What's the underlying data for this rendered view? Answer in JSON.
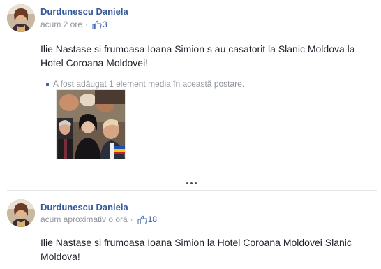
{
  "posts": [
    {
      "author": "Durdunescu Daniela",
      "time": "acum 2 ore",
      "separator": "·",
      "likes": "3",
      "text": "Ilie Nastase si frumoasa Ioana Simion s au casatorit la Slanic Moldova la Hotel Coroana Moldovei!",
      "media_note": "A fost adăugat 1 element media în această postare.",
      "icons": {
        "avatar": "avatar",
        "like": "like-icon",
        "media": "photo-thumbnail"
      }
    },
    {
      "author": "Durdunescu Daniela",
      "time": "acum aproximativ o oră",
      "separator": "·",
      "likes": "18",
      "text": "Ilie Nastase si frumoasa Ioana Simion la Hotel Coroana Moldovei Slanic Moldova!",
      "icons": {
        "avatar": "avatar",
        "like": "like-icon"
      }
    }
  ],
  "more_button": "more-dots-icon",
  "colors": {
    "link": "#365899",
    "meta": "#90949c",
    "text": "#1d2129",
    "divider": "#e5e5e5"
  }
}
